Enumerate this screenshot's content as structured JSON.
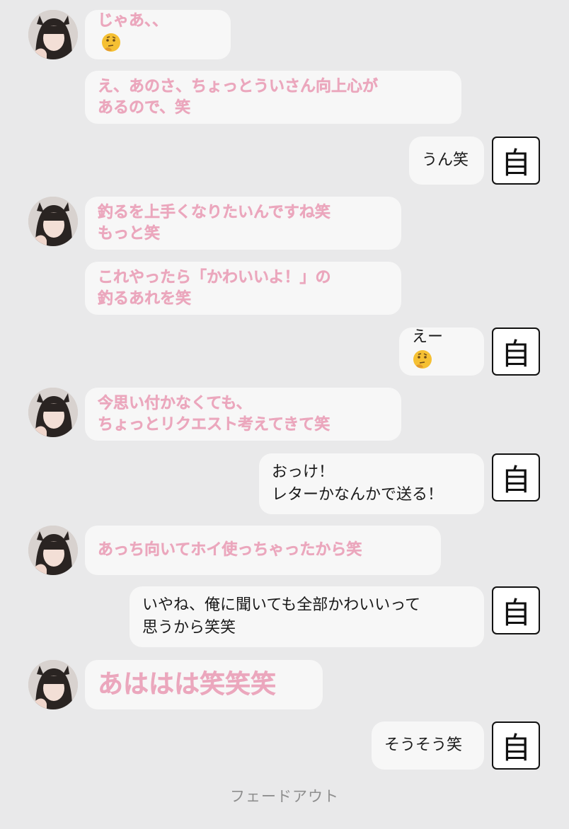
{
  "self_label": "自",
  "footer": "フェードアウト",
  "msgs": {
    "m1": "じゃあ、、",
    "m2a": "え、あのさ、ちょっとういさん向上心が",
    "m2b": "あるので、笑",
    "m3": "うん笑",
    "m4a": "釣るを上手くなりたいんですね笑",
    "m4b": "もっと笑",
    "m5a": "これやったら「かわいいよ！」の",
    "m5b": "釣るあれを笑",
    "m6": "えー",
    "m7a": "今思い付かなくても、",
    "m7b": "ちょっとリクエスト考えてきて笑",
    "m8a": "おっけ！",
    "m8b": "レターかなんかで送る！",
    "m9": "あっち向いてホイ使っちゃったから笑",
    "m10a": "いやね、俺に聞いても全部かわいいって",
    "m10b": "思うから笑笑",
    "m11": "あははは笑笑笑",
    "m12": "そうそう笑"
  },
  "icons": {
    "thinking": "thinking-face-emoji",
    "avatar": "profile-photo"
  }
}
